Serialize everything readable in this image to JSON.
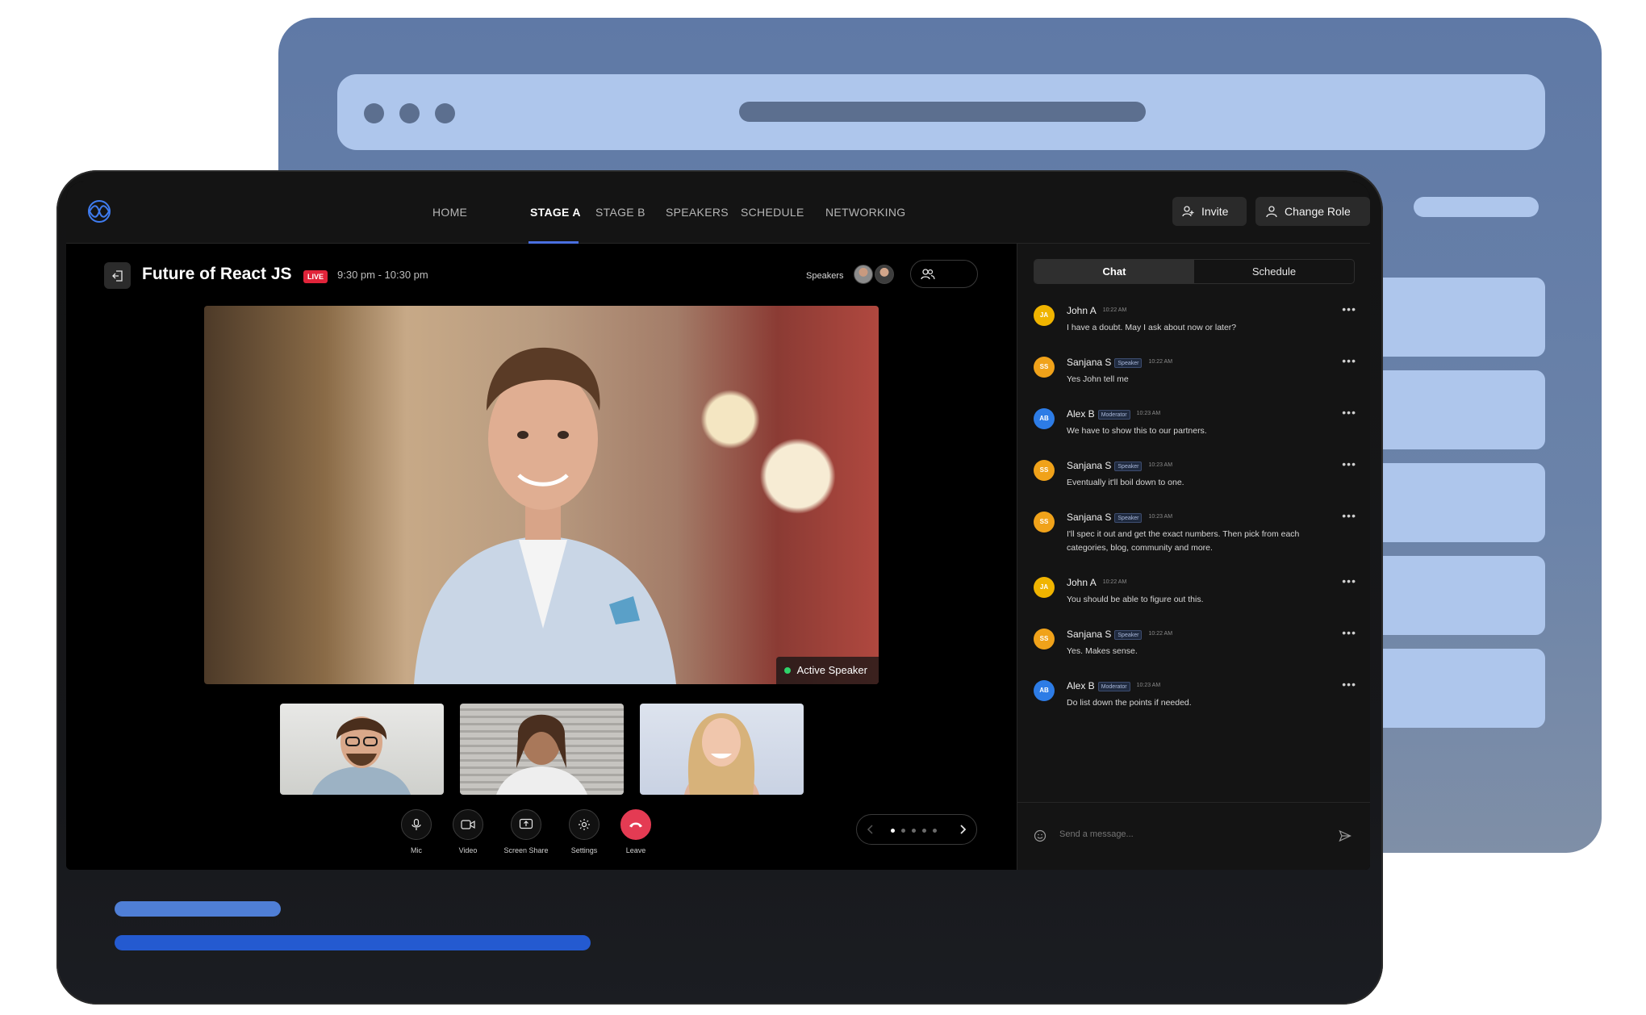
{
  "nav": {
    "items": [
      "HOME",
      "STAGE A",
      "STAGE B",
      "SPEAKERS",
      "SCHEDULE",
      "NETWORKING"
    ],
    "active": "STAGE A",
    "invite_label": "Invite",
    "change_role_label": "Change Role"
  },
  "session": {
    "title": "Future of React JS",
    "live_label": "LIVE",
    "time": "9:30 pm - 10:30 pm",
    "speakers_label": "Speakers"
  },
  "video": {
    "active_speaker_label": "Active Speaker"
  },
  "controls": {
    "mic": "Mic",
    "video": "Video",
    "screen_share": "Screen Share",
    "settings": "Settings",
    "leave": "Leave"
  },
  "chat": {
    "tabs": [
      "Chat",
      "Schedule"
    ],
    "active_tab": "Chat",
    "placeholder": "Send a message...",
    "messages": [
      {
        "initials": "JA",
        "name": "John A",
        "role": "",
        "time": "10:22 AM",
        "text": "I have a doubt. May I ask about now or later?",
        "color": "#f0b400"
      },
      {
        "initials": "SS",
        "name": "Sanjana S",
        "role": "Speaker",
        "time": "10:22 AM",
        "text": "Yes John tell me",
        "color": "#f0a21a"
      },
      {
        "initials": "AB",
        "name": "Alex B",
        "role": "Moderator",
        "time": "10:23 AM",
        "text": "We have to show this to our partners.",
        "color": "#2d7ce6"
      },
      {
        "initials": "SS",
        "name": "Sanjana S",
        "role": "Speaker",
        "time": "10:23 AM",
        "text": "Eventually it'll boil down to one.",
        "color": "#f0a21a"
      },
      {
        "initials": "SS",
        "name": "Sanjana S",
        "role": "Speaker",
        "time": "10:23 AM",
        "text": "I'll spec it out and get the exact numbers. Then pick from each categories, blog, community and more.",
        "color": "#f0a21a"
      },
      {
        "initials": "JA",
        "name": "John A",
        "role": "",
        "time": "10:22 AM",
        "text": "You should be able to figure out this.",
        "color": "#f0b400"
      },
      {
        "initials": "SS",
        "name": "Sanjana S",
        "role": "Speaker",
        "time": "10:22 AM",
        "text": "Yes. Makes sense.",
        "color": "#f0a21a"
      },
      {
        "initials": "AB",
        "name": "Alex B",
        "role": "Moderator",
        "time": "10:23 AM",
        "text": "Do list down the points if needed.",
        "color": "#2d7ce6"
      }
    ]
  },
  "pager": {
    "total_dots": 5,
    "active_dot": 1
  }
}
